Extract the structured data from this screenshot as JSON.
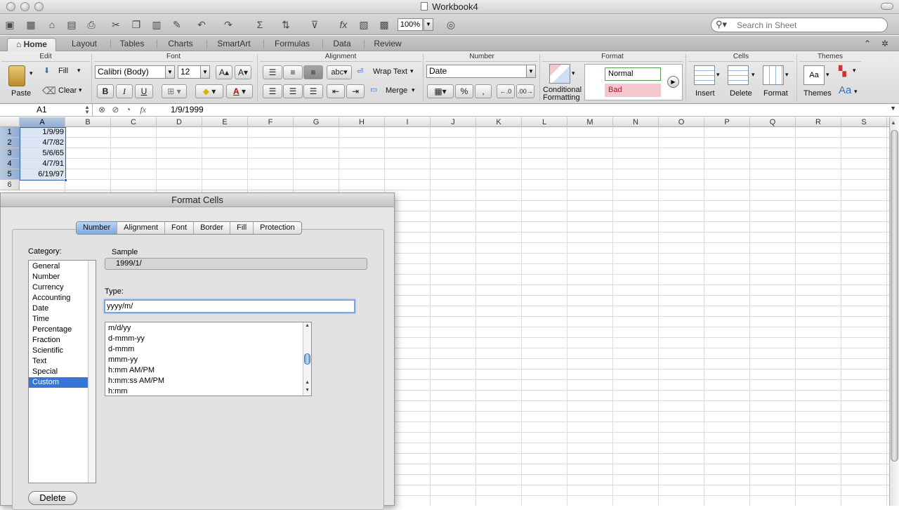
{
  "window": {
    "title": "Workbook4"
  },
  "toolbar": {
    "zoom": "100%",
    "search_placeholder": "Search in Sheet"
  },
  "ribbon_tabs": [
    "Home",
    "Layout",
    "Tables",
    "Charts",
    "SmartArt",
    "Formulas",
    "Data",
    "Review"
  ],
  "ribbon": {
    "groups": {
      "edit": "Edit",
      "font": "Font",
      "alignment": "Alignment",
      "number": "Number",
      "format": "Format",
      "cells": "Cells",
      "themes": "Themes"
    },
    "paste": "Paste",
    "fill": "Fill",
    "clear": "Clear",
    "font_name": "Calibri (Body)",
    "font_size": "12",
    "bold": "B",
    "italic": "I",
    "underline": "U",
    "abc": "abc",
    "wrap_text": "Wrap Text",
    "merge": "Merge",
    "number_format": "Date",
    "percent": "%",
    "comma": ",",
    "conditional_formatting": "Conditional",
    "conditional_formatting_2": "Formatting",
    "style_normal": "Normal",
    "style_bad": "Bad",
    "insert": "Insert",
    "delete": "Delete",
    "format_btn": "Format",
    "themes_btn": "Themes",
    "font_a_up": "A",
    "font_a_down": "A",
    "aa": "Aa"
  },
  "formula_bar": {
    "name_box": "A1",
    "fx": "fx",
    "content": "1/9/1999"
  },
  "sheet": {
    "columns": [
      "A",
      "B",
      "C",
      "D",
      "E",
      "F",
      "G",
      "H",
      "I",
      "J",
      "K",
      "L",
      "M",
      "N",
      "O",
      "P",
      "Q",
      "R",
      "S"
    ],
    "rows": [
      "1",
      "2",
      "3",
      "4",
      "5",
      "6"
    ],
    "cells_a": [
      "1/9/99",
      "4/7/82",
      "5/6/65",
      "4/7/91",
      "6/19/97"
    ]
  },
  "dialog": {
    "title": "Format Cells",
    "tabs": [
      "Number",
      "Alignment",
      "Font",
      "Border",
      "Fill",
      "Protection"
    ],
    "category_label": "Category:",
    "categories": [
      "General",
      "Number",
      "Currency",
      "Accounting",
      "Date",
      "Time",
      "Percentage",
      "Fraction",
      "Scientific",
      "Text",
      "Special",
      "Custom"
    ],
    "selected_category": "Custom",
    "sample_label": "Sample",
    "sample_value": "1999/1/",
    "type_label": "Type:",
    "type_value": "yyyy/m/",
    "type_list": [
      "m/d/yy",
      "d-mmm-yy",
      "d-mmm",
      "mmm-yy",
      "h:mm AM/PM",
      "h:mm:ss AM/PM",
      "h:mm"
    ],
    "delete_button": "Delete"
  },
  "colors": {
    "selection_blue": "#3875d7",
    "tab_active": "#7fa9e2",
    "bad_fill": "#f6c7cf"
  }
}
